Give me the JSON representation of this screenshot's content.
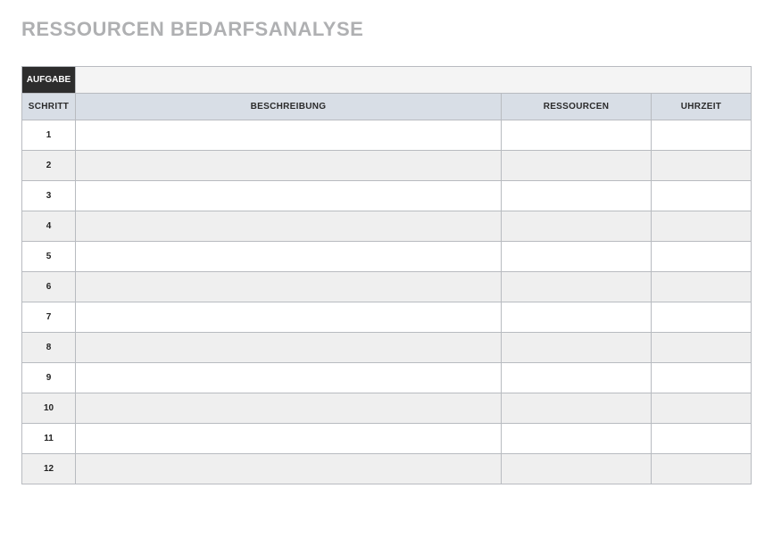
{
  "title": "RESSOURCEN BEDARFSANALYSE",
  "aufgabe": {
    "label": "AUFGABE",
    "value": ""
  },
  "columns": {
    "schritt": "SCHRITT",
    "beschreibung": "BESCHREIBUNG",
    "ressourcen": "RESSOURCEN",
    "uhrzeit": "UHRZEIT"
  },
  "rows": [
    {
      "step": "1",
      "beschreibung": "",
      "ressourcen": "",
      "uhrzeit": ""
    },
    {
      "step": "2",
      "beschreibung": "",
      "ressourcen": "",
      "uhrzeit": ""
    },
    {
      "step": "3",
      "beschreibung": "",
      "ressourcen": "",
      "uhrzeit": ""
    },
    {
      "step": "4",
      "beschreibung": "",
      "ressourcen": "",
      "uhrzeit": ""
    },
    {
      "step": "5",
      "beschreibung": "",
      "ressourcen": "",
      "uhrzeit": ""
    },
    {
      "step": "6",
      "beschreibung": "",
      "ressourcen": "",
      "uhrzeit": ""
    },
    {
      "step": "7",
      "beschreibung": "",
      "ressourcen": "",
      "uhrzeit": ""
    },
    {
      "step": "8",
      "beschreibung": "",
      "ressourcen": "",
      "uhrzeit": ""
    },
    {
      "step": "9",
      "beschreibung": "",
      "ressourcen": "",
      "uhrzeit": ""
    },
    {
      "step": "10",
      "beschreibung": "",
      "ressourcen": "",
      "uhrzeit": ""
    },
    {
      "step": "11",
      "beschreibung": "",
      "ressourcen": "",
      "uhrzeit": ""
    },
    {
      "step": "12",
      "beschreibung": "",
      "ressourcen": "",
      "uhrzeit": ""
    }
  ]
}
